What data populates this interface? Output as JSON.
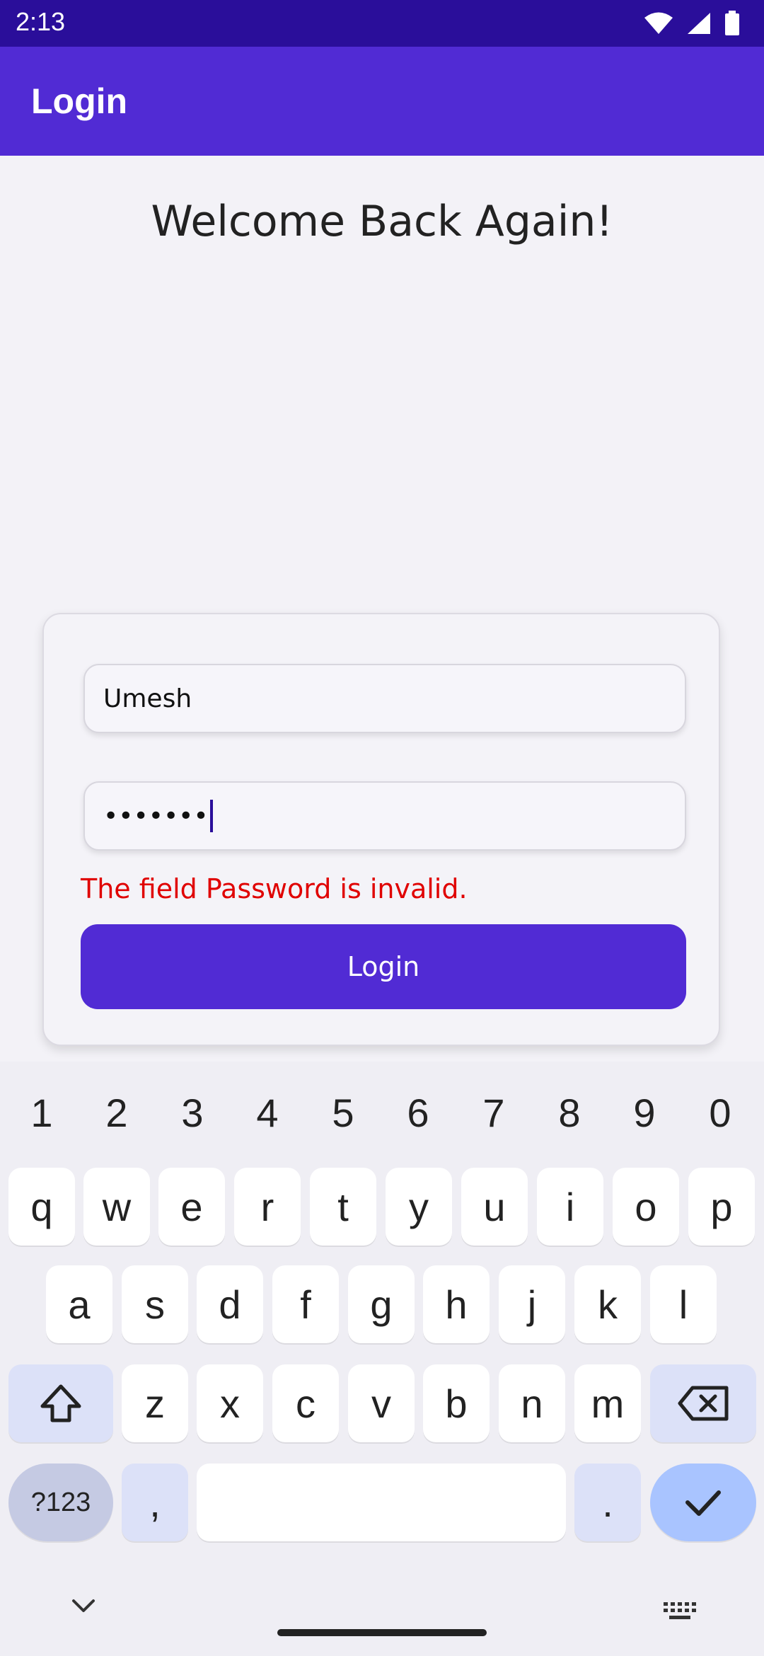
{
  "status_bar": {
    "time": "2:13",
    "icons": [
      "wifi-icon",
      "signal-icon",
      "battery-icon"
    ]
  },
  "app_bar": {
    "title": "Login"
  },
  "main": {
    "welcome": "Welcome Back Again!",
    "username_value": "Umesh",
    "password_value": "•••••••",
    "error_text": "The field Password is invalid.",
    "login_label": "Login"
  },
  "keyboard": {
    "number_row": [
      "1",
      "2",
      "3",
      "4",
      "5",
      "6",
      "7",
      "8",
      "9",
      "0"
    ],
    "row1": [
      "q",
      "w",
      "e",
      "r",
      "t",
      "y",
      "u",
      "i",
      "o",
      "p"
    ],
    "row2": [
      "a",
      "s",
      "d",
      "f",
      "g",
      "h",
      "j",
      "k",
      "l"
    ],
    "row3": [
      "z",
      "x",
      "c",
      "v",
      "b",
      "n",
      "m"
    ],
    "symbols_label": "?123",
    "comma": ",",
    "period": "."
  },
  "colors": {
    "status_bar": "#2A0E9A",
    "app_bar": "#512BD4",
    "button": "#512BD4",
    "error": "#E00000"
  }
}
